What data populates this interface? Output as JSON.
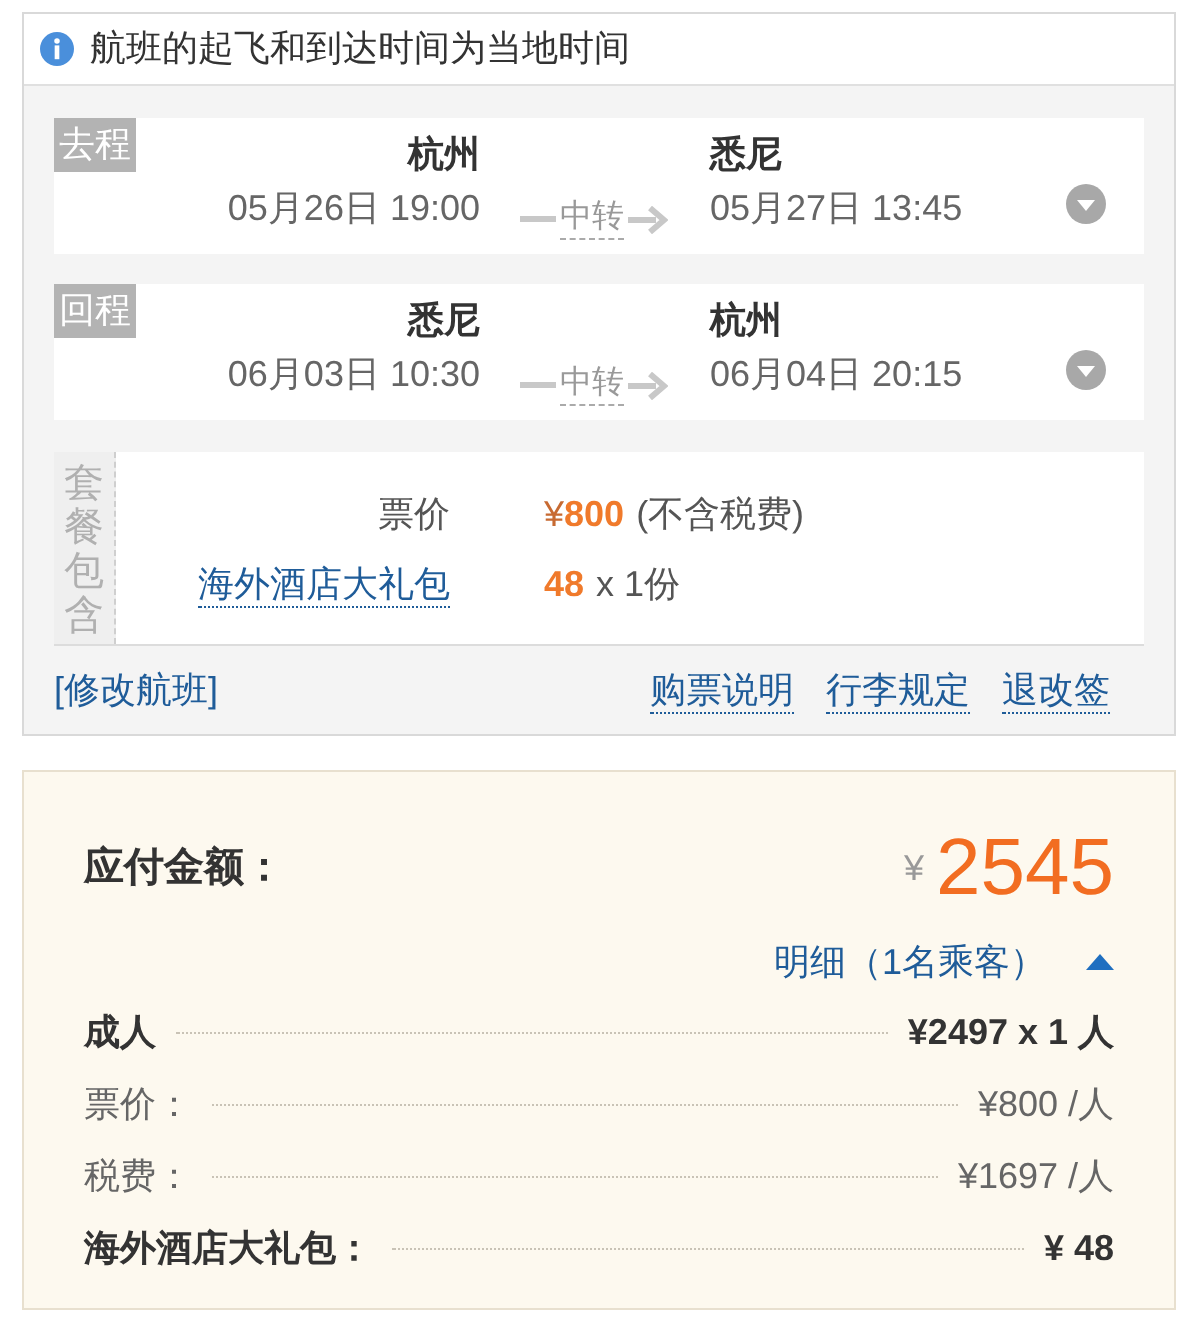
{
  "notice": {
    "text": "航班的起飞和到达时间为当地时间"
  },
  "flights": [
    {
      "label": "去程",
      "departure": {
        "city": "杭州",
        "time": "05月26日 19:00"
      },
      "transfer": "中转",
      "arrival": {
        "city": "悉尼",
        "time": "05月27日 13:45"
      },
      "expanded": false
    },
    {
      "label": "回程",
      "departure": {
        "city": "悉尼",
        "time": "06月03日 10:30"
      },
      "transfer": "中转",
      "arrival": {
        "city": "杭州",
        "time": "06月04日 20:15"
      },
      "expanded": false
    }
  ],
  "package": {
    "label": "套餐包含",
    "items": [
      {
        "kind": "fare",
        "name": "票价",
        "currency": "¥",
        "amount": "800",
        "note": "(不含税费)"
      },
      {
        "kind": "link",
        "name": "海外酒店大礼包",
        "amount": "48",
        "note": "x 1份"
      }
    ]
  },
  "footer": {
    "edit_link": "[修改航班]",
    "links": [
      "购票说明",
      "行李规定",
      "退改签"
    ]
  },
  "payment": {
    "label": "应付金额：",
    "currency": "¥",
    "total": "2545",
    "details": {
      "label": "明细（1名乘客）",
      "expanded": true
    },
    "rows": [
      {
        "kind": "subtotal",
        "label": "成人",
        "value": "¥2497 x 1 人"
      },
      {
        "kind": "item",
        "label": "票价：",
        "value": "¥800 /人"
      },
      {
        "kind": "item",
        "label": "税费：",
        "value": "¥1697 /人"
      },
      {
        "kind": "subtotal",
        "label": "海外酒店大礼包：",
        "value": "¥ 48"
      }
    ]
  }
}
